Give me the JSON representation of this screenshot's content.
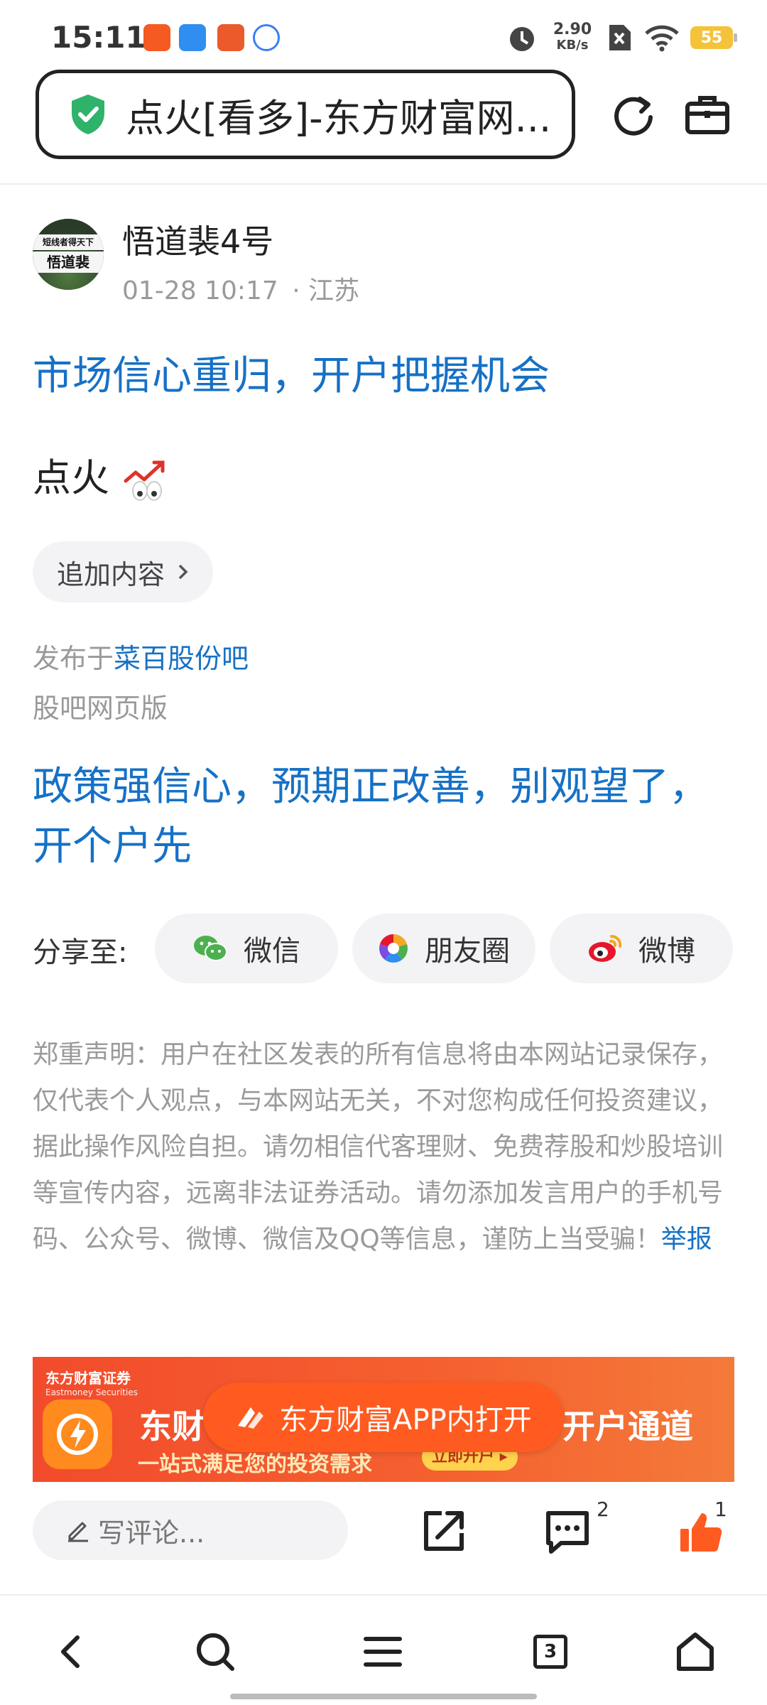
{
  "status_bar": {
    "time": "15:11",
    "net_speed_value": "2.90",
    "net_speed_unit": "KB/s",
    "battery": "55"
  },
  "url_bar": {
    "title": "点火[看多]-东方财富网..."
  },
  "author": {
    "avatar_text_top": "短线者得天下",
    "avatar_text_main": "悟道裴",
    "name": "悟道裴4号",
    "datetime": "01-28 10:17",
    "location": "· 江苏"
  },
  "post": {
    "title": "市场信心重归，开户把握机会",
    "text": "点火",
    "add_more": "追加内容",
    "published_prefix": "发布于",
    "published_bar": "菜百股份吧",
    "web_version": "股吧网页版",
    "promo": "政策强信心，预期正改善，别观望了，开个户先"
  },
  "share": {
    "label": "分享至:",
    "items": [
      {
        "label": "微信",
        "color": "#4cb050"
      },
      {
        "label": "朋友圈",
        "color": "#f5a623"
      },
      {
        "label": "微博",
        "color": "#e6162d"
      }
    ]
  },
  "disclaimer": {
    "text": "郑重声明：用户在社区发表的所有信息将由本网站记录保存，仅代表个人观点，与本网站无关，不对您构成任何投资建议，据此操作风险自担。请勿相信代客理财、免费荐股和炒股培训等宣传内容，远离非法证券活动。请勿添加发言用户的手机号码、公众号、微博、微信及QQ等信息，谨防上当受骗！",
    "report": "举报"
  },
  "banner": {
    "brand_cn": "东方财富证券",
    "brand_en": "Eastmoney Securities",
    "headline_left": "东财",
    "headline_right": "开户通道",
    "subline": "一站式满足您的投资需求",
    "cta": "立即开户",
    "open_app": "东方财富APP内打开"
  },
  "actions": {
    "comment_placeholder": "写评论...",
    "comment_count": "2",
    "like_count": "1"
  },
  "nav": {
    "tabs_count": "3"
  },
  "colors": {
    "accent": "#1671c6",
    "brand_orange": "#ff5a1f"
  }
}
